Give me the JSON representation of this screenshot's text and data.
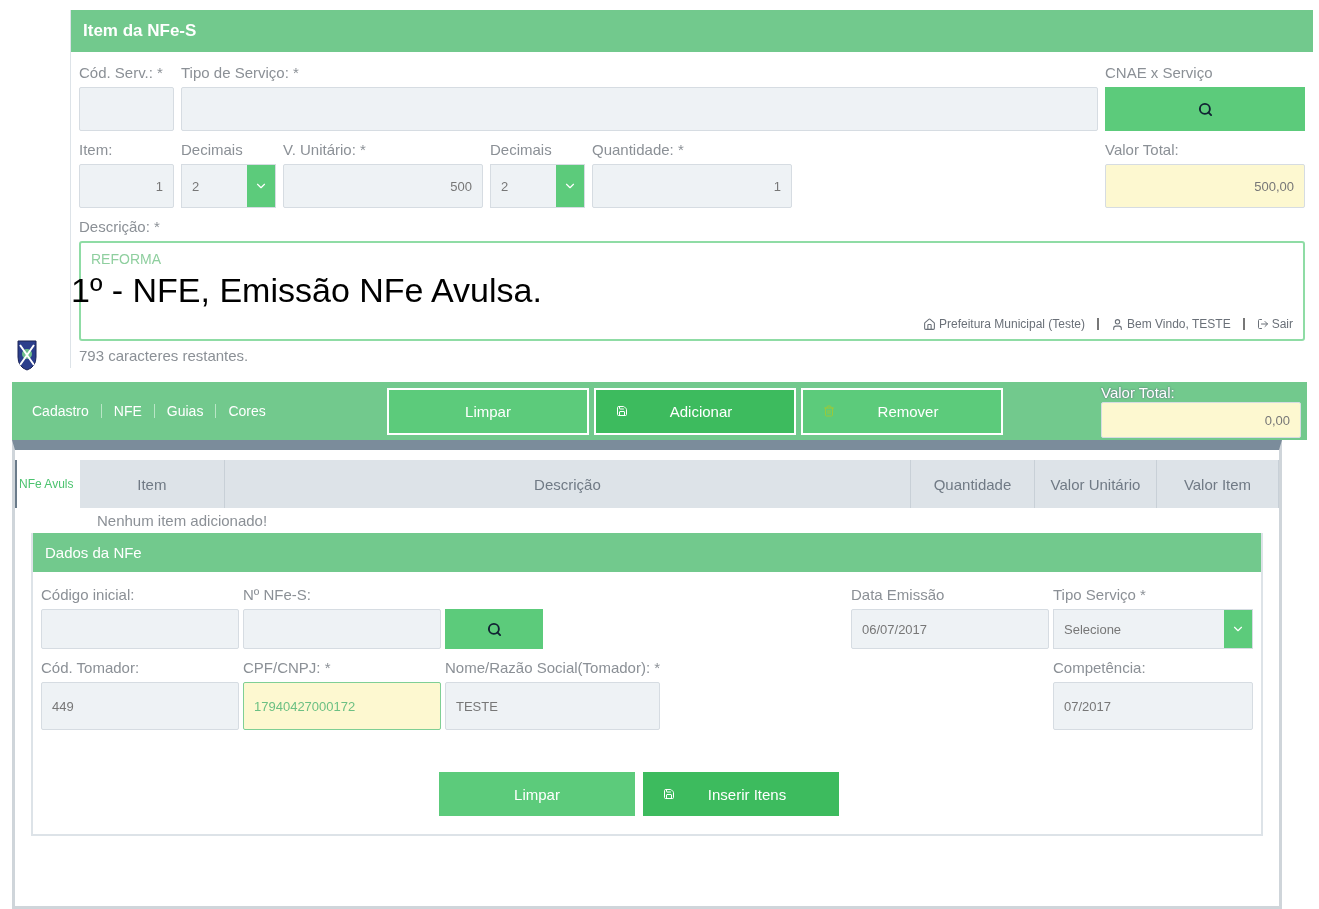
{
  "caption": "1º - NFE, Emissão NFe Avulsa.",
  "item_panel": {
    "title": "Item da NFe-S",
    "row_1": [
      {
        "label": "Cód. Serv.: *",
        "kind": "input"
      },
      {
        "label": "Tipo de Serviço: *",
        "kind": "input"
      },
      {
        "label": "CNAE x Serviço",
        "kind": "search"
      }
    ],
    "row_2": [
      {
        "label": "Item:",
        "kind": "input",
        "value": "1"
      },
      {
        "label": "Decimais",
        "kind": "select",
        "value": "2"
      },
      {
        "label": "V. Unitário: *",
        "kind": "input",
        "value": "500"
      },
      {
        "label": "Decimais",
        "kind": "select",
        "value": "2"
      },
      {
        "label": "Quantidade: *",
        "kind": "input",
        "value": "1"
      },
      {
        "label": "Valor Total:",
        "kind": "total",
        "value": "500,00"
      }
    ],
    "description": {
      "label": "Descrição: *",
      "value": "REFORMA",
      "counter": "793 caracteres restantes."
    }
  },
  "header_links": [
    {
      "label": "Prefeitura Municipal (Teste)",
      "kind": "home"
    },
    {
      "label": "Bem Vindo, TESTE",
      "kind": "user"
    },
    {
      "label": "Sair",
      "kind": "exit"
    }
  ],
  "nav": {
    "items": [
      "Cadastro",
      "NFE",
      "Guias",
      "Cores"
    ],
    "buttons": [
      {
        "label": "Limpar",
        "kind": "plain"
      },
      {
        "label": "Adicionar",
        "kind": "save"
      },
      {
        "label": "Remover",
        "kind": "delete"
      }
    ],
    "total": {
      "label": "Valor Total:",
      "value": "0,00"
    }
  },
  "tab": {
    "label": "NFe Avuls",
    "selected": true
  },
  "items_table": {
    "columns": [
      "Item",
      "Descrição",
      "Quantidade",
      "Valor Unitário",
      "Valor Item"
    ],
    "empty_message": "Nenhum item adicionado!"
  },
  "nfe_panel": {
    "title": "Dados da NFe",
    "row_1": [
      {
        "label": "Código inicial:",
        "kind": "input"
      },
      {
        "label": "Nº NFe-S:",
        "kind": "input"
      },
      {
        "kind": "search"
      },
      {
        "label": "Data Emissão",
        "kind": "input",
        "value": "06/07/2017"
      },
      {
        "label": "Tipo Serviço *",
        "kind": "select",
        "value": "Selecione"
      }
    ],
    "row_2": [
      {
        "label": "Cód. Tomador:",
        "kind": "input",
        "value": "449"
      },
      {
        "label": "CPF/CNPJ: *",
        "kind": "highlight",
        "value": "17940427000172"
      },
      {
        "label": "Nome/Razão Social(Tomador): *",
        "kind": "input",
        "value": "TESTE"
      },
      {
        "label": "Competência:",
        "kind": "input",
        "value": "07/2017"
      }
    ],
    "buttons": [
      {
        "label": "Limpar",
        "kind": "plain"
      },
      {
        "label": "Inserir Itens",
        "kind": "save"
      }
    ]
  }
}
